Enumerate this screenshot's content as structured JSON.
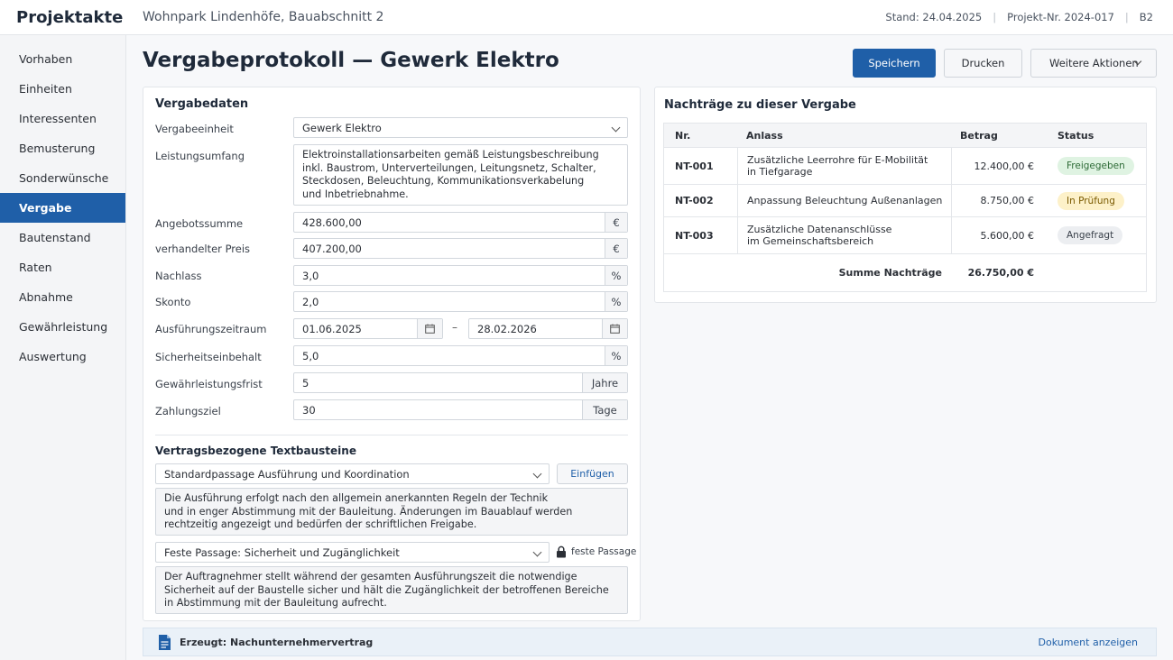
{
  "app": {
    "brand": "Projektakte",
    "project": "Wohnpark Lindenhöfe, Bauabschnitt 2"
  },
  "meta": {
    "stand": "Stand: 24.04.2025",
    "projekt_nr": "Projekt-Nr. 2024-017",
    "bauabschnitt": "B2"
  },
  "sidebar": {
    "items": [
      {
        "label": "Vorhaben"
      },
      {
        "label": "Einheiten"
      },
      {
        "label": "Interessenten"
      },
      {
        "label": "Bemusterung"
      },
      {
        "label": "Sonderwünsche"
      },
      {
        "label": "Vergabe"
      },
      {
        "label": "Bautenstand"
      },
      {
        "label": "Raten"
      },
      {
        "label": "Abnahme"
      },
      {
        "label": "Gewährleistung"
      },
      {
        "label": "Auswertung"
      }
    ],
    "active": "Vergabe"
  },
  "page": {
    "title": "Vergabeprotokoll — Gewerk Elektro"
  },
  "toolbar": {
    "save": "Speichern",
    "print": "Drucken",
    "more": "Weitere Aktionen"
  },
  "vergabedaten": {
    "title": "Vergabedaten",
    "vergabeeinheit": {
      "label": "Vergabeeinheit",
      "value": "Gewerk Elektro"
    },
    "leistungsumfang": {
      "label": "Leistungsumfang",
      "lines": [
        "Elektroinstallationsarbeiten gemäß Leistungsbeschreibung",
        "inkl. Baustrom, Unterverteilungen, Leitungsnetz, Schalter,",
        "Steckdosen, Beleuchtung, Kommunikationsverkabelung",
        "und Inbetriebnahme."
      ]
    },
    "angebotssumme": {
      "label": "Angebotssumme",
      "value": "428.600,00",
      "unit": "€"
    },
    "verhandelt": {
      "label": "verhandelter Preis",
      "value": "407.200,00",
      "unit": "€"
    },
    "nachlass": {
      "label": "Nachlass",
      "value": "3,0",
      "unit": "%"
    },
    "skonto": {
      "label": "Skonto",
      "value": "2,0",
      "unit": "%"
    },
    "zeitraum": {
      "label": "Ausführungszeitraum",
      "from": "01.06.2025",
      "to": "28.02.2026",
      "dash": "–"
    },
    "sicherheit": {
      "label": "Sicherheitseinbehalt",
      "value": "5,0",
      "unit": "%"
    },
    "gewaehrleistung": {
      "label": "Gewährleistungsfrist",
      "value": "5",
      "unit": "Jahre"
    },
    "zahlungsziel": {
      "label": "Zahlungsziel",
      "value": "30",
      "unit": "Tage"
    }
  },
  "textbausteine": {
    "title": "Vertragsbezogene Textbausteine",
    "select1": "Standardpassage Ausführung und Koordination",
    "insert": "Einfügen",
    "text1": [
      "Die Ausführung erfolgt nach den allgemein anerkannten Regeln der Technik",
      "und in enger Abstimmung mit der Bauleitung. Änderungen im Bauablauf werden",
      "rechtzeitig angezeigt und bedürfen der schriftlichen Freigabe."
    ],
    "select2": "Feste Passage: Sicherheit und Zugänglichkeit",
    "fixed_label": "feste Passage",
    "text2": [
      "Der Auftragnehmer stellt während der gesamten Ausführungszeit die notwendige",
      "Sicherheit auf der Baustelle sicher und hält die Zugänglichkeit der betroffenen Bereiche",
      "in Abstimmung mit der Bauleitung aufrecht."
    ]
  },
  "nachtraege": {
    "title": "Nachträge zu dieser Vergabe",
    "headers": {
      "nr": "Nr.",
      "anlass": "Anlass",
      "betrag": "Betrag",
      "status": "Status"
    },
    "rows": [
      {
        "nr": "NT-001",
        "anlass": [
          "Zusätzliche Leerrohre für E-Mobilität",
          "in Tiefgarage"
        ],
        "betrag": "12.400,00 €",
        "status": "Freigegeben",
        "status_bg": "#dff3e2",
        "status_fg": "#2e6b37"
      },
      {
        "nr": "NT-002",
        "anlass": [
          "Anpassung Beleuchtung Außenanlagen"
        ],
        "betrag": "8.750,00 €",
        "status": "In Prüfung",
        "status_bg": "#fdf1c9",
        "status_fg": "#7a5a00"
      },
      {
        "nr": "NT-003",
        "anlass": [
          "Zusätzliche Datenanschlüsse",
          "im Gemeinschaftsbereich"
        ],
        "betrag": "5.600,00 €",
        "status": "Angefragt",
        "status_bg": "#eceef1",
        "status_fg": "#3a414b"
      }
    ],
    "summe_label": "Summe Nachträge",
    "summe": "26.750,00 €"
  },
  "footer": {
    "created": "Erzeugt: Nachunternehmervertrag",
    "link": "Dokument anzeigen"
  },
  "colors": {
    "primary": "#1f5fa8"
  }
}
